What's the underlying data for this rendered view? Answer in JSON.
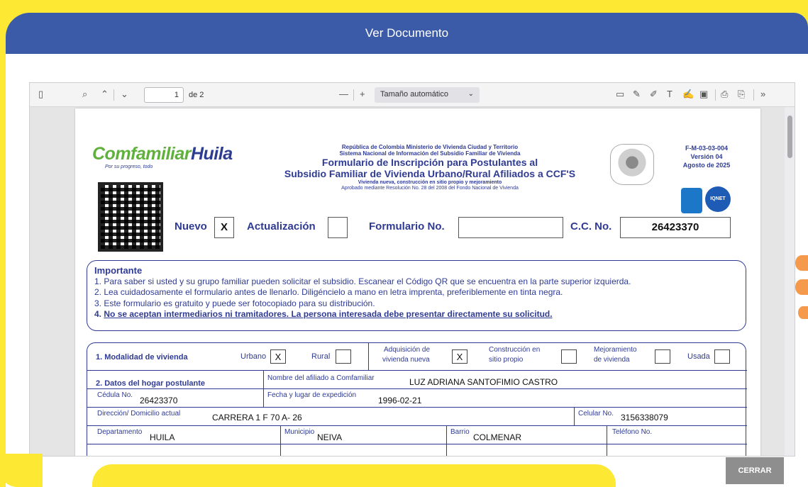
{
  "modal": {
    "title": "Ver Documento"
  },
  "viewer_toolbar": {
    "sidebar_icon": "sidebar-toggle-icon",
    "search_icon": "search-icon",
    "page_current": "1",
    "page_total_label": "de 2",
    "zoom_out": "—",
    "zoom_in": "+",
    "zoom_select": "Tamaño automático",
    "tools": [
      "comment-icon",
      "edit-icon",
      "draw-icon",
      "text-icon",
      "ink-icon",
      "image-icon",
      "print-icon",
      "save-icon",
      "more-icon"
    ]
  },
  "document": {
    "logo_text_1": "Comfamiliar",
    "logo_text_2": "Huila",
    "logo_tagline": "Por su progreso, todo",
    "header": {
      "line1": "República de Colombia Ministerio de Vivienda Ciudad y Territorio",
      "line2": "Sistema Nacional de Información del Subsidio Familiar de Vivienda",
      "title1": "Formulario de Inscripción para Postulantes al",
      "title2": "Subsidio Familiar de Vivienda Urbano/Rural Afiliados a CCF'S",
      "line3": "Vivienda nueva, construcción en sitio propio y mejoramiento",
      "line4": "Aprobado mediante Resolución No. 28 del 2008 del Fondo Nacional de Vivienda"
    },
    "code": {
      "id": "F-M-03-03-004",
      "version": "Versión 04",
      "date": "Agosto de 2025"
    },
    "badge_text": "IQNET",
    "top_row": {
      "nuevo_label": "Nuevo",
      "nuevo_mark": "X",
      "actualizacion_label": "Actualización",
      "formulario_label": "Formulario No.",
      "cc_label": "C.C. No.",
      "cc_value": "26423370"
    },
    "important": {
      "title": "Importante",
      "items": [
        "1. Para saber si usted y su grupo familiar pueden solicitar el subsidio. Escanear el Código QR que se encuentra en la parte superior izquierda.",
        "2. Lea cuidadosamente el formulario antes de llenarlo. Diligéncielo a mano en letra imprenta, preferiblemente en tinta negra.",
        "3. Este formulario es gratuito y puede ser fotocopiado para su distribución."
      ],
      "item4_num": "4.",
      "item4_text": "No se aceptan intermediarios ni tramitadores. La persona interesada debe presentar directamente su solicitud."
    },
    "section1": {
      "label": "1. Modalidad de vivienda",
      "urbano": "Urbano",
      "urbano_mark": "X",
      "rural": "Rural",
      "adq1": "Adquisición de",
      "adq2": "vivienda nueva",
      "adq_mark": "X",
      "cons1": "Construcción en",
      "cons2": "sitio propio",
      "mej1": "Mejoramiento",
      "mej2": "de vivienda",
      "usada": "Usada"
    },
    "section2": {
      "label": "2. Datos del hogar postulante",
      "afiliado_label": "Nombre del afiliado a Comfamiliar",
      "afiliado_value": "LUZ ADRIANA SANTOFIMIO CASTRO",
      "cedula_label": "Cédula No.",
      "cedula_value": "26423370",
      "fecha_label": "Fecha y lugar de expedición",
      "fecha_value": "1996-02-21",
      "direccion_label": "Dirección/ Domicilio actual",
      "direccion_value": "CARRERA 1 F 70 A- 26",
      "celular_label": "Celular No.",
      "celular_value": "3156338079",
      "departamento_label": "Departamento",
      "departamento_value": "HUILA",
      "municipio_label": "Municipio",
      "municipio_value": "NEIVA",
      "barrio_label": "Barrio",
      "barrio_value": "COLMENAR",
      "telefono_label": "Teléfono No."
    }
  },
  "footer": {
    "close_label": "CERRAR"
  },
  "colors": {
    "header_blue": "#3b5ba8",
    "frame_yellow": "#fde934",
    "form_blue": "#2f3b93",
    "button_gray": "#8e8e8e"
  }
}
